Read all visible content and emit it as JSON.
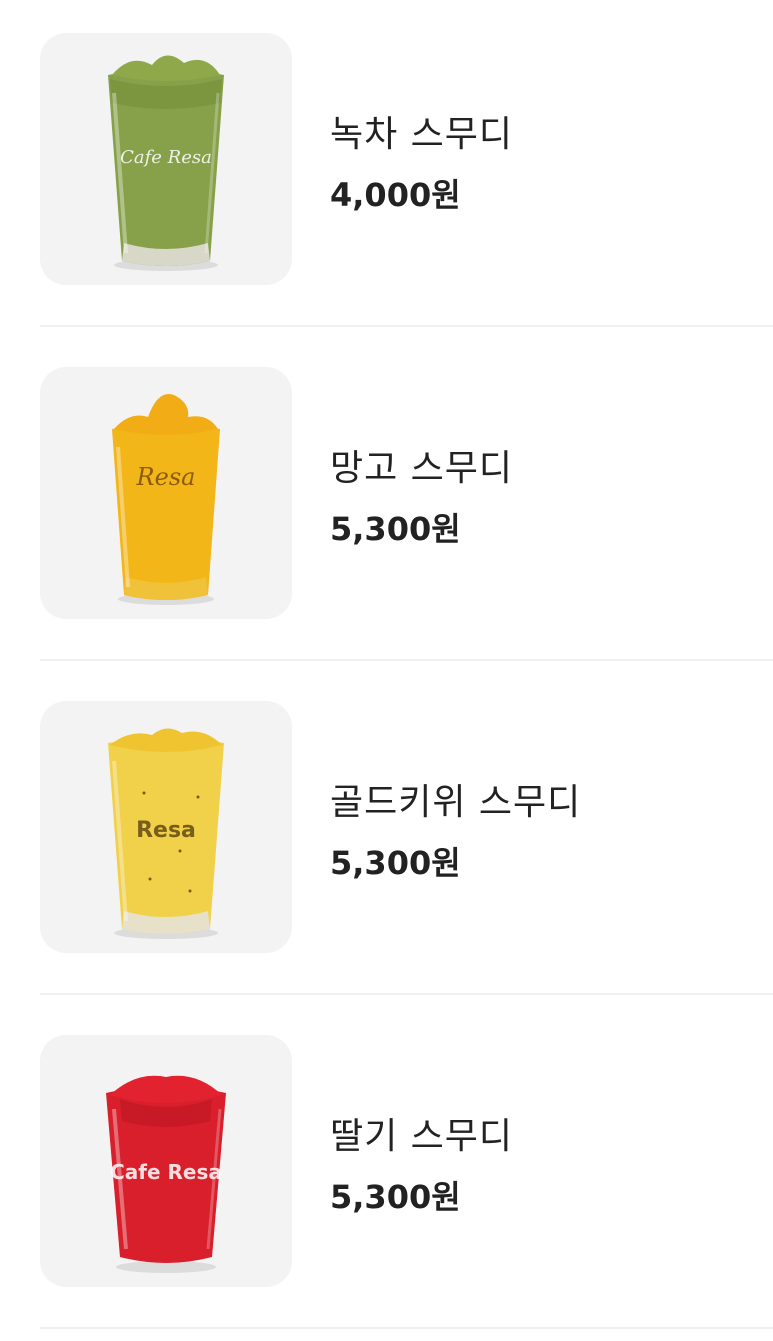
{
  "menu": {
    "items": [
      {
        "name": "녹차 스무디",
        "price": "4,000원",
        "image_icon": "green-tea-smoothie-icon",
        "cup_brand": "Cafe Resa",
        "colors": {
          "top": "#8fa84a",
          "body": "#87a14a",
          "dark": "#6f8a36"
        }
      },
      {
        "name": "망고 스무디",
        "price": "5,300원",
        "image_icon": "mango-smoothie-icon",
        "cup_brand": "Resa",
        "colors": {
          "top": "#f2ad16",
          "body": "#f3b619",
          "dark": "#d8930c"
        }
      },
      {
        "name": "골드키위 스무디",
        "price": "5,300원",
        "image_icon": "gold-kiwi-smoothie-icon",
        "cup_brand": "Resa",
        "colors": {
          "top": "#efc430",
          "body": "#f1d04a",
          "dark": "#d9ad23"
        }
      },
      {
        "name": "딸기 스무디",
        "price": "5,300원",
        "image_icon": "strawberry-smoothie-icon",
        "cup_brand": "Cafe Resa",
        "colors": {
          "top": "#e2222f",
          "body": "#d91f2c",
          "dark": "#b5141f"
        }
      }
    ]
  }
}
